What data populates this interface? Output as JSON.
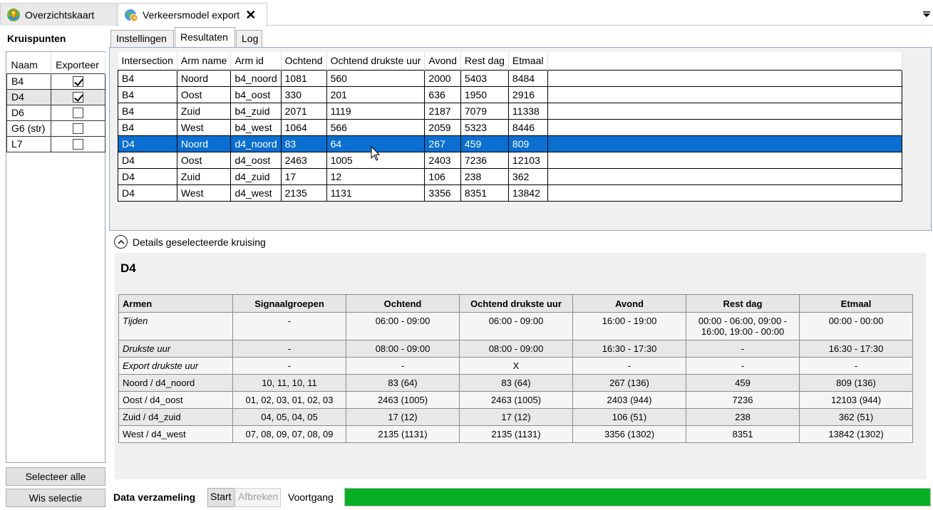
{
  "tabs": [
    {
      "label": "Overzichtskaart",
      "icon": "map-pin-icon",
      "active": false
    },
    {
      "label": "Verkeersmodel export",
      "icon": "globe-export-icon",
      "active": true
    }
  ],
  "left": {
    "title": "Kruispunten",
    "columns": [
      "Naam",
      "Exporteer"
    ],
    "rows": [
      {
        "name": "B4",
        "export": true
      },
      {
        "name": "D4",
        "export": true
      },
      {
        "name": "D6",
        "export": false
      },
      {
        "name": "G6 (str)",
        "export": false
      },
      {
        "name": "L7",
        "export": false
      }
    ],
    "select_all": "Selecteer alle",
    "clear_selection": "Wis selectie"
  },
  "subtabs": [
    "Instellingen",
    "Resultaten",
    "Log"
  ],
  "results": {
    "columns": [
      "Intersection",
      "Arm name",
      "Arm id",
      "Ochtend",
      "Ochtend drukste uur",
      "Avond",
      "Rest dag",
      "Etmaal"
    ],
    "rows": [
      [
        "B4",
        "Noord",
        "b4_noord",
        "1081",
        "560",
        "2000",
        "5403",
        "8484"
      ],
      [
        "B4",
        "Oost",
        "b4_oost",
        "330",
        "201",
        "636",
        "1950",
        "2916"
      ],
      [
        "B4",
        "Zuid",
        "b4_zuid",
        "2071",
        "1119",
        "2187",
        "7079",
        "11338"
      ],
      [
        "B4",
        "West",
        "b4_west",
        "1064",
        "566",
        "2059",
        "5323",
        "8446"
      ],
      [
        "D4",
        "Noord",
        "d4_noord",
        "83",
        "64",
        "267",
        "459",
        "809"
      ],
      [
        "D4",
        "Oost",
        "d4_oost",
        "2463",
        "1005",
        "2403",
        "7236",
        "12103"
      ],
      [
        "D4",
        "Zuid",
        "d4_zuid",
        "17",
        "12",
        "106",
        "238",
        "362"
      ],
      [
        "D4",
        "West",
        "d4_west",
        "2135",
        "1131",
        "3356",
        "8351",
        "13842"
      ]
    ],
    "selected_index": 4
  },
  "details": {
    "header": "Details geselecteerde kruising",
    "title": "D4",
    "columns": [
      "Armen",
      "Signaalgroepen",
      "Ochtend",
      "Ochtend drukste uur",
      "Avond",
      "Rest dag",
      "Etmaal"
    ],
    "rows": [
      {
        "italic": true,
        "cells": [
          "Tijden",
          "-",
          "06:00 - 09:00",
          "06:00 - 09:00",
          "16:00 - 19:00",
          "00:00 - 06:00, 09:00 - 16:00, 19:00 - 00:00",
          "00:00 - 00:00"
        ]
      },
      {
        "italic": true,
        "cells": [
          "Drukste uur",
          "-",
          "08:00 - 09:00",
          "08:00 - 09:00",
          "16:30 - 17:30",
          "-",
          "16:30 - 17:30"
        ]
      },
      {
        "italic": true,
        "cells": [
          "Export drukste uur",
          "-",
          "-",
          "X",
          "-",
          "-",
          "-"
        ]
      },
      {
        "italic": false,
        "cells": [
          "Noord / d4_noord",
          "10, 11, 10, 11",
          "83 (64)",
          "83 (64)",
          "267 (136)",
          "459",
          "809 (136)"
        ]
      },
      {
        "italic": false,
        "cells": [
          "Oost / d4_oost",
          "01, 02, 03, 01, 02, 03",
          "2463 (1005)",
          "2463 (1005)",
          "2403 (944)",
          "7236",
          "12103 (944)"
        ]
      },
      {
        "italic": false,
        "cells": [
          "Zuid / d4_zuid",
          "04, 05, 04, 05",
          "17 (12)",
          "17 (12)",
          "106 (51)",
          "238",
          "362 (51)"
        ]
      },
      {
        "italic": false,
        "cells": [
          "West / d4_west",
          "07, 08, 09, 07, 08, 09",
          "2135 (1131)",
          "2135 (1131)",
          "3356 (1302)",
          "8351",
          "13842 (1302)"
        ]
      }
    ]
  },
  "bottom": {
    "label": "Data verzameling",
    "start": "Start",
    "abort": "Afbreken",
    "progress_label": "Voortgang",
    "progress_value": 1.0
  },
  "colors": {
    "selection": "#0a6fd0",
    "progress": "#06b025"
  }
}
